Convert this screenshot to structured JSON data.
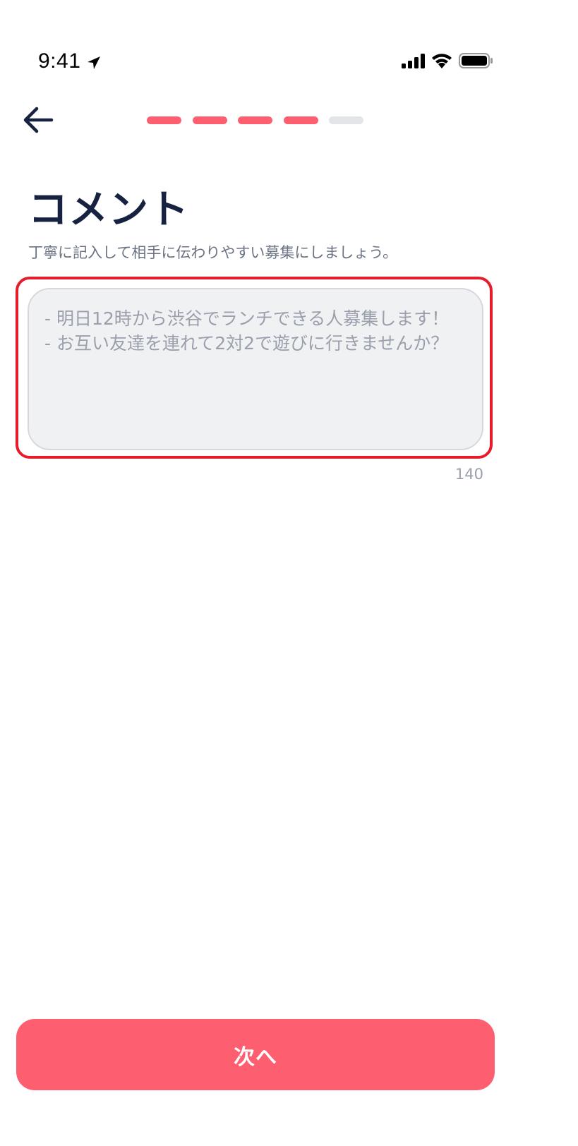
{
  "status_bar": {
    "time": "9:41",
    "icons": [
      "location-arrow-icon",
      "cellular-signal-icon",
      "wifi-icon",
      "battery-icon"
    ]
  },
  "header": {
    "back_icon": "arrow-left-icon",
    "progress": {
      "total_steps": 5,
      "completed_steps": 4,
      "active_color": "#FE5F70",
      "inactive_color": "#E3E5E9"
    }
  },
  "page": {
    "title": "コメント",
    "subtitle": "丁寧に記入して相手に伝わりやすい募集にしましょう。"
  },
  "comment": {
    "value": "",
    "placeholder": "- 明日12時から渋谷でランチできる人募集します！\n- お互い友達を連れて2対2で遊びに行きませんか？",
    "char_limit": "140"
  },
  "footer": {
    "next_label": "次へ"
  },
  "colors": {
    "accent": "#FE5F70",
    "title": "#16223F",
    "highlight": "#E51C2A"
  }
}
